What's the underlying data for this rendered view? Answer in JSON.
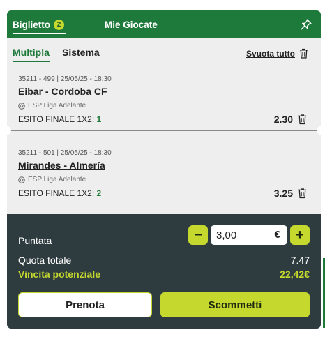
{
  "header": {
    "tab_ticket": "Biglietto",
    "ticket_count": "2",
    "tab_my_bets": "Mie Giocate",
    "pin_icon": "pin-icon"
  },
  "subtabs": {
    "multipla": "Multipla",
    "sistema": "Sistema",
    "clear_all": "Svuota tutto"
  },
  "bets": [
    {
      "meta": "35211 - 499 | 25/05/25 - 18:30",
      "event": "Eibar - Cordoba CF",
      "league": "ESP Liga Adelante",
      "market": "ESITO FINALE 1X2:",
      "pick": "1",
      "odds": "2.30"
    },
    {
      "meta": "35211 - 501 | 25/05/25 - 18:30",
      "event": "Mirandes - Almería",
      "league": "ESP Liga Adelante",
      "market": "ESITO FINALE 1X2:",
      "pick": "2",
      "odds": "3.25"
    }
  ],
  "footer": {
    "stake_label": "Puntata",
    "stake_value": "3,00",
    "currency": "€",
    "minus": "−",
    "plus": "+",
    "total_odds_label": "Quota totale",
    "total_odds_value": "7.47",
    "potential_win_label": "Vincita potenziale",
    "potential_win_value": "22,42€",
    "book_button": "Prenota",
    "bet_button": "Scommetti"
  },
  "colors": {
    "brand_green": "#1e7a3a",
    "accent_lime": "#c4d82e",
    "footer_bg": "#2e3c40"
  }
}
